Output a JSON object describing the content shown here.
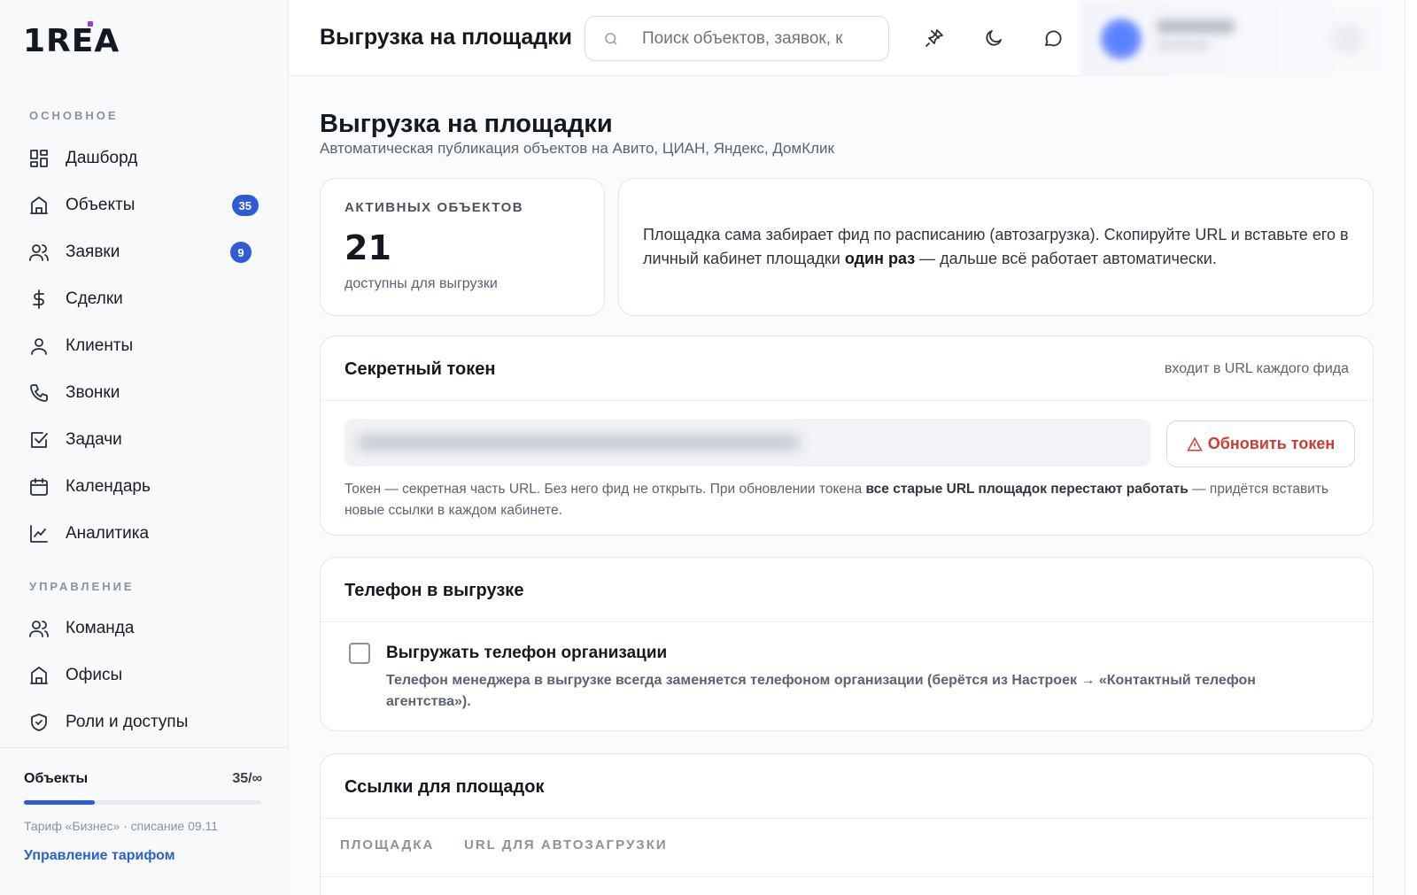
{
  "app": {
    "logo": "1REA",
    "header_title": "Выгрузка на площадки",
    "search_placeholder": "Поиск объектов, заявок, к"
  },
  "sidebar": {
    "section_main": "ОСНОВНОЕ",
    "section_manage": "УПРАВЛЕНИЕ",
    "items": [
      {
        "label": "Дашборд",
        "icon": "dashboard-icon"
      },
      {
        "label": "Объекты",
        "icon": "building-icon",
        "badge": "35"
      },
      {
        "label": "Заявки",
        "icon": "users-icon",
        "badge": "9"
      },
      {
        "label": "Сделки",
        "icon": "dollar-icon"
      },
      {
        "label": "Клиенты",
        "icon": "user-icon"
      },
      {
        "label": "Звонки",
        "icon": "phone-icon"
      },
      {
        "label": "Задачи",
        "icon": "checkbox-icon"
      },
      {
        "label": "Календарь",
        "icon": "calendar-icon"
      },
      {
        "label": "Аналитика",
        "icon": "chart-icon"
      }
    ],
    "manage_items": [
      {
        "label": "Команда",
        "icon": "users-icon"
      },
      {
        "label": "Офисы",
        "icon": "building-icon"
      },
      {
        "label": "Роли и доступы",
        "icon": "shield-icon"
      }
    ],
    "plan": {
      "title": "Объекты",
      "count": "35/∞",
      "progress": 0.3,
      "note": "Тариф «Бизнес» · списание 09.11",
      "link": "Управление тарифом"
    }
  },
  "page": {
    "title": "Выгрузка на площадки",
    "subtitle": "Автоматическая публикация объектов на Авито, ЦИАН, Яндекс, ДомКлик"
  },
  "stats": {
    "label": "АКТИВНЫХ ОБЪЕКТОВ",
    "value": "21",
    "note": "доступны для выгрузки"
  },
  "info": {
    "text_before": "Площадка сама забирает фид по расписанию (автозагрузка). Скопируйте URL и вставьте его в личный кабинет площадки ",
    "text_bold": "один раз",
    "text_after": " — дальше всё работает автоматически."
  },
  "token": {
    "title": "Секретный токен",
    "hint": "входит в URL каждого фида",
    "refresh_button": "Обновить токен",
    "note_before": "Токен — секретная часть URL. Без него фид не открыть. При обновлении токена ",
    "note_bold": "все старые URL площадок перестают работать",
    "note_after": " — придётся вставить новые ссылки в каждом кабинете."
  },
  "phone": {
    "title": "Телефон в выгрузке",
    "checkbox_label": "Выгружать телефон организации",
    "checked": false,
    "description": "Телефон менеджера в выгрузке всегда заменяется телефоном организации (берётся из Настроек → «Контактный телефон агентства»)."
  },
  "links": {
    "title": "Ссылки для площадок",
    "columns": [
      "ПЛОЩАДКА",
      "URL ДЛЯ АВТОЗАГРУЗКИ"
    ]
  },
  "colors": {
    "accent": "#2f5bd6",
    "danger": "#d23b30",
    "link": "#2a62c9"
  }
}
